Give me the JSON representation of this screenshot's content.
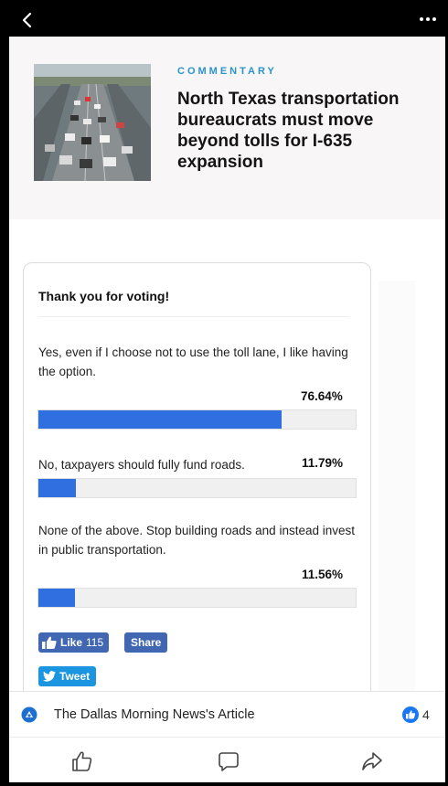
{
  "article": {
    "kicker": "COMMENTARY",
    "headline": "North Texas transportation bureaucrats must move beyond tolls for I-635 expansion"
  },
  "poll": {
    "title": "Thank you for voting!",
    "options": [
      {
        "text": "Yes, even if I choose not to use the toll lane, I like having the option.",
        "percent_label": "76.64%",
        "percent": 76.64
      },
      {
        "text": "No, taxpayers should fully fund roads.",
        "percent_label": "11.79%",
        "percent": 11.79
      },
      {
        "text": "None of the above. Stop building roads and instead invest in public transportation.",
        "percent_label": "11.56%",
        "percent": 11.56
      }
    ],
    "bar_color": "#2f6fe0"
  },
  "social": {
    "like_label": "Like",
    "like_count": "115",
    "share_label": "Share",
    "tweet_label": "Tweet"
  },
  "source": {
    "name": "The Dallas Morning News's Article",
    "reaction_count": "4"
  },
  "icons": {
    "back": "chevron-left-icon",
    "more": "more-dots-icon",
    "like": "thumbs-up-icon",
    "comment": "comment-bubble-icon",
    "share": "share-arrow-icon"
  },
  "colors": {
    "accent": "#2a93c9",
    "facebook": "#4267b2",
    "twitter": "#1b95e0"
  }
}
